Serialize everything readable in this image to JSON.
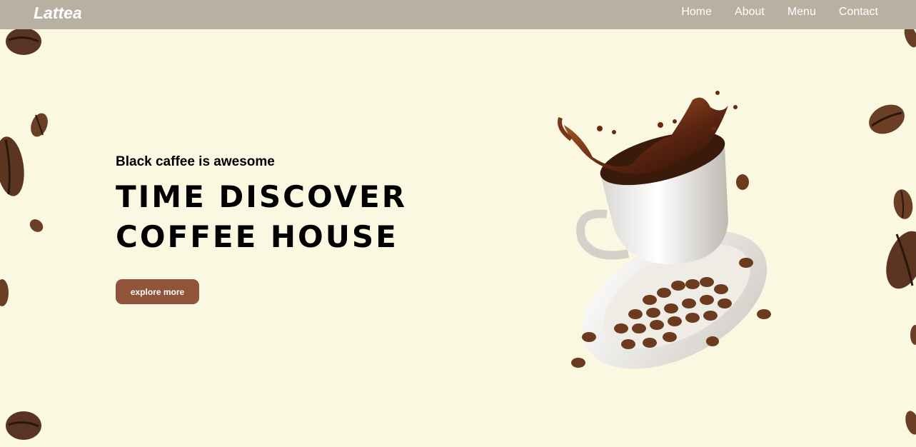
{
  "navbar": {
    "logo": "Lattea",
    "links": [
      "Home",
      "About",
      "Menu",
      "Contact"
    ]
  },
  "hero": {
    "subtitle": "Black caffee is awesome",
    "headline_line1": "TIME DISCOVER",
    "headline_line2": "COFFEE HOUSE",
    "cta_label": "explore more"
  },
  "colors": {
    "background": "#faf8e0",
    "navbar": "#b8b0a0",
    "button": "#8f543a",
    "coffee_bean": "#6b3e26"
  },
  "icons": [
    "coffee-bean-icon",
    "coffee-cup-splash-icon"
  ]
}
